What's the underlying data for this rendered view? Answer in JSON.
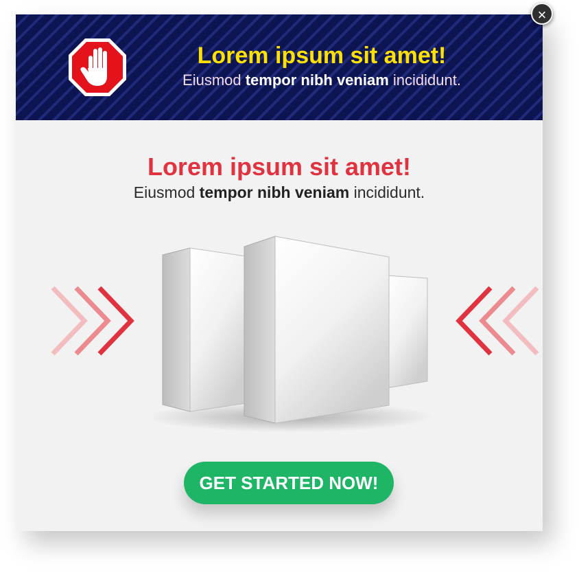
{
  "banner": {
    "title": "Lorem ipsum sit amet!",
    "subtitle": {
      "part1": "Eiusmod ",
      "bold": "tempor nibh veniam",
      "part2": " incididunt."
    },
    "stop_icon": "stop-hand-icon",
    "background_color": "#0c1452",
    "title_color": "#ffe100"
  },
  "close_button": {
    "label": "×",
    "icon": "close-icon"
  },
  "main": {
    "title": "Lorem ipsum sit amet!",
    "subtitle": {
      "part1": "Eiusmod ",
      "bold": "tempor nibh veniam",
      "part2": " incididunt."
    },
    "title_color": "#e0333f",
    "left_arrows_icon": "chevrons-right-icon",
    "right_arrows_icon": "chevrons-left-icon",
    "product_image": "product-boxes-image"
  },
  "cta": {
    "label": "GET STARTED NOW!",
    "color": "#1fb567"
  }
}
